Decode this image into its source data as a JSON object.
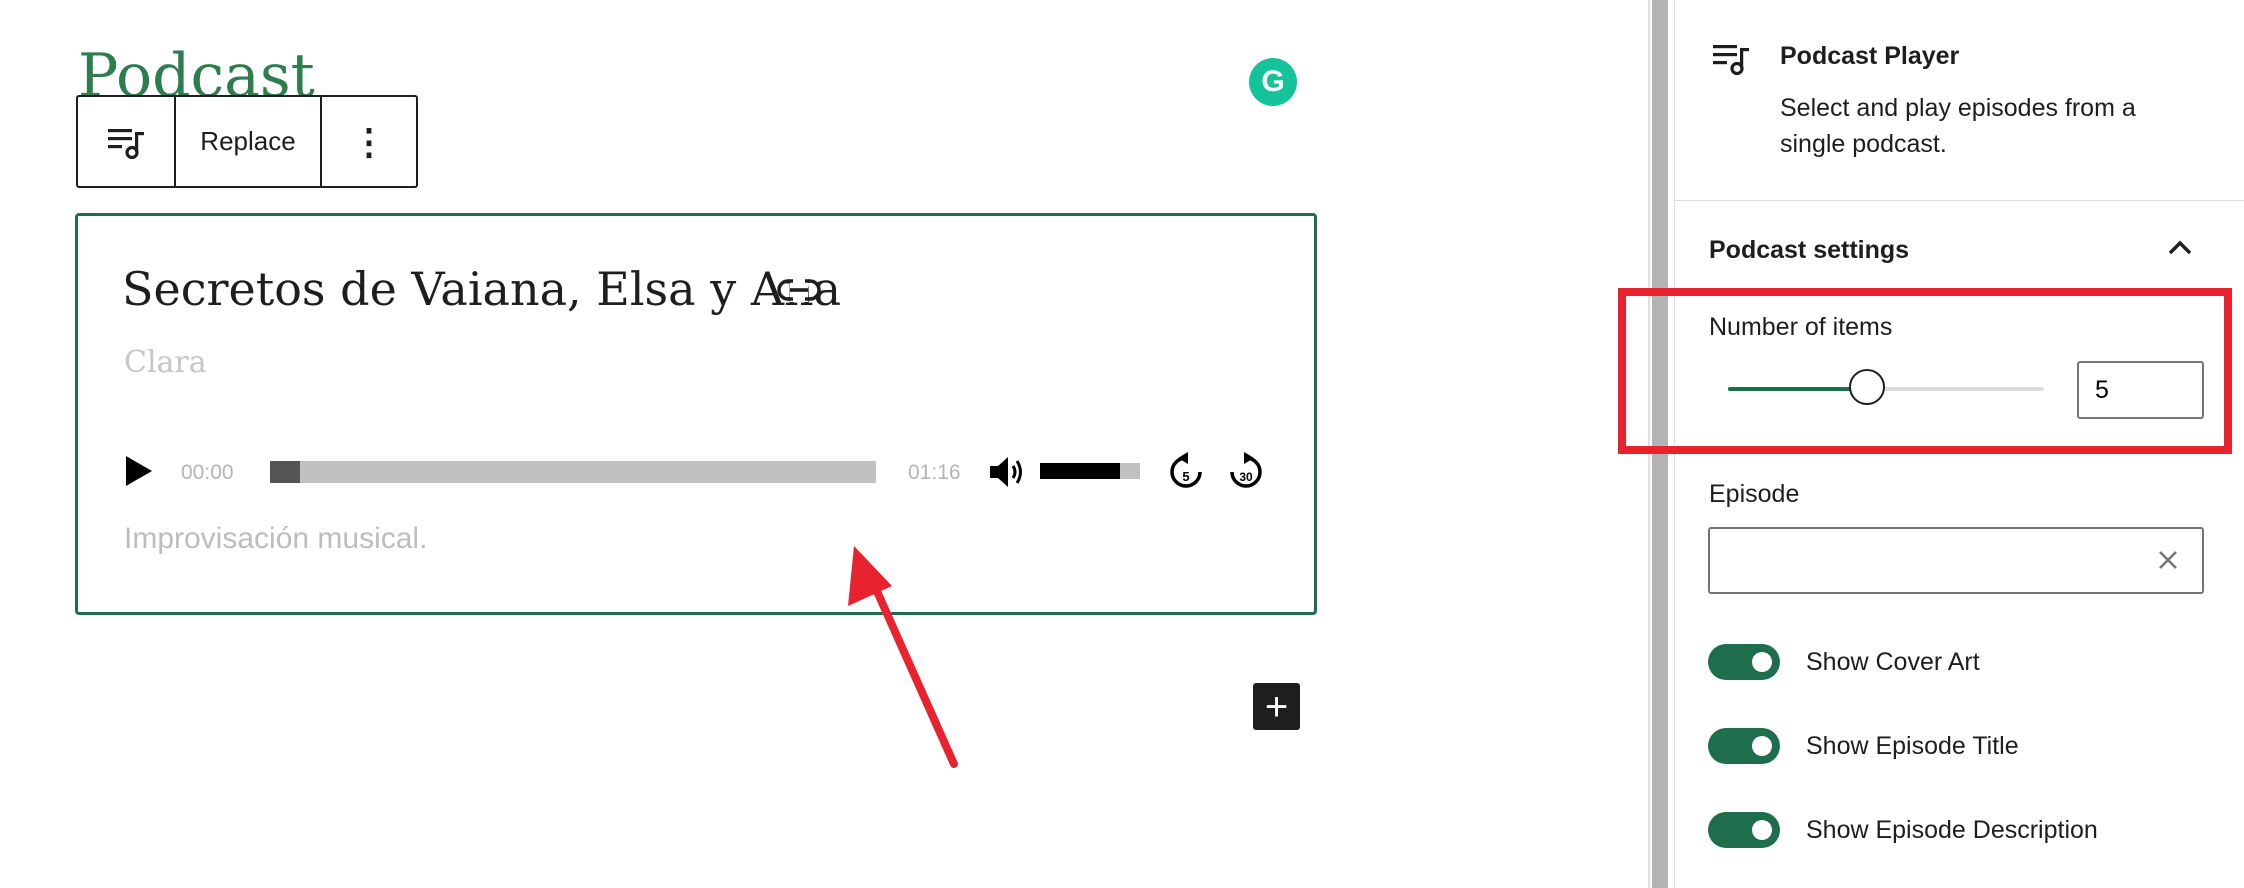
{
  "editor": {
    "post_title": "Podcast",
    "grammarly_letter": "G",
    "toolbar": {
      "block_icon": "playlist-music-icon",
      "replace_label": "Replace",
      "more_label": "⋮"
    },
    "player": {
      "episode_title": "Secretos de Vaiana, Elsa y Ana",
      "author": "Clara",
      "current_time": "00:00",
      "duration": "01:16",
      "progress_fraction": 0.05,
      "volume_fraction": 0.8,
      "skip_back_label": "5",
      "skip_forward_label": "30",
      "description": "Improvisación musical."
    },
    "add_block_label": "+"
  },
  "sidebar": {
    "block_card": {
      "icon": "playlist-music-icon",
      "title": "Podcast Player",
      "description": "Select and play episodes from a single podcast."
    },
    "podcast_settings": {
      "title": "Podcast settings",
      "number_of_items_label": "Number of items",
      "number_of_items_value": "5",
      "range_fraction": 0.44,
      "episode_label": "Episode",
      "episode_value": "",
      "toggles": [
        {
          "label": "Show Cover Art",
          "on": true
        },
        {
          "label": "Show Episode Title",
          "on": true
        },
        {
          "label": "Show Episode Description",
          "on": true
        }
      ]
    }
  },
  "colors": {
    "accent_green": "#1e6e4e",
    "title_green": "#2e7d4f",
    "annotation_red": "#e8232f",
    "grammarly": "#15c39a"
  }
}
